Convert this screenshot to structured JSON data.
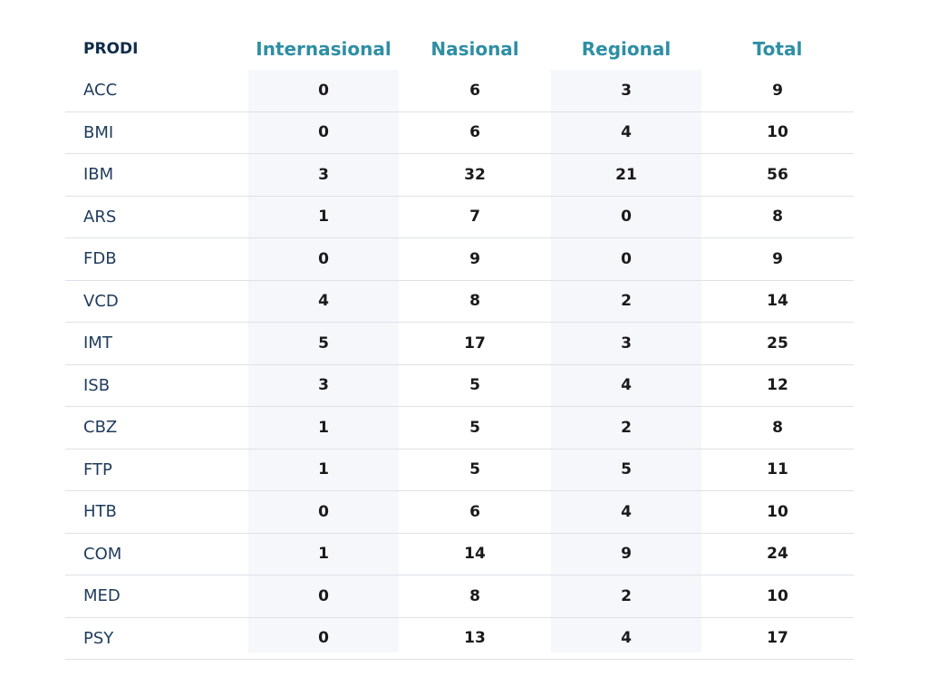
{
  "table": {
    "headers": {
      "prodi": "PRODI",
      "internasional": "Internasional",
      "nasional": "Nasional",
      "regional": "Regional",
      "total": "Total"
    },
    "rows": [
      {
        "prodi": "ACC",
        "internasional": "0",
        "nasional": "6",
        "regional": "3",
        "total": "9"
      },
      {
        "prodi": "BMI",
        "internasional": "0",
        "nasional": "6",
        "regional": "4",
        "total": "10"
      },
      {
        "prodi": "IBM",
        "internasional": "3",
        "nasional": "32",
        "regional": "21",
        "total": "56"
      },
      {
        "prodi": "ARS",
        "internasional": "1",
        "nasional": "7",
        "regional": "0",
        "total": "8"
      },
      {
        "prodi": "FDB",
        "internasional": "0",
        "nasional": "9",
        "regional": "0",
        "total": "9"
      },
      {
        "prodi": "VCD",
        "internasional": "4",
        "nasional": "8",
        "regional": "2",
        "total": "14"
      },
      {
        "prodi": "IMT",
        "internasional": "5",
        "nasional": "17",
        "regional": "3",
        "total": "25"
      },
      {
        "prodi": "ISB",
        "internasional": "3",
        "nasional": "5",
        "regional": "4",
        "total": "12"
      },
      {
        "prodi": "CBZ",
        "internasional": "1",
        "nasional": "5",
        "regional": "2",
        "total": "8"
      },
      {
        "prodi": "FTP",
        "internasional": "1",
        "nasional": "5",
        "regional": "5",
        "total": "11"
      },
      {
        "prodi": "HTB",
        "internasional": "0",
        "nasional": "6",
        "regional": "4",
        "total": "10"
      },
      {
        "prodi": "COM",
        "internasional": "1",
        "nasional": "14",
        "regional": "9",
        "total": "24"
      },
      {
        "prodi": "MED",
        "internasional": "0",
        "nasional": "8",
        "regional": "2",
        "total": "10"
      },
      {
        "prodi": "PSY",
        "internasional": "0",
        "nasional": "13",
        "regional": "4",
        "total": "17"
      }
    ]
  },
  "colors": {
    "header_accent": "#2e8fa3",
    "prodi_header": "#0f2d4a",
    "prodi_text": "#1f3b5c",
    "shaded_column": "#f6f7fb",
    "row_divider": "#dfe1e6"
  }
}
